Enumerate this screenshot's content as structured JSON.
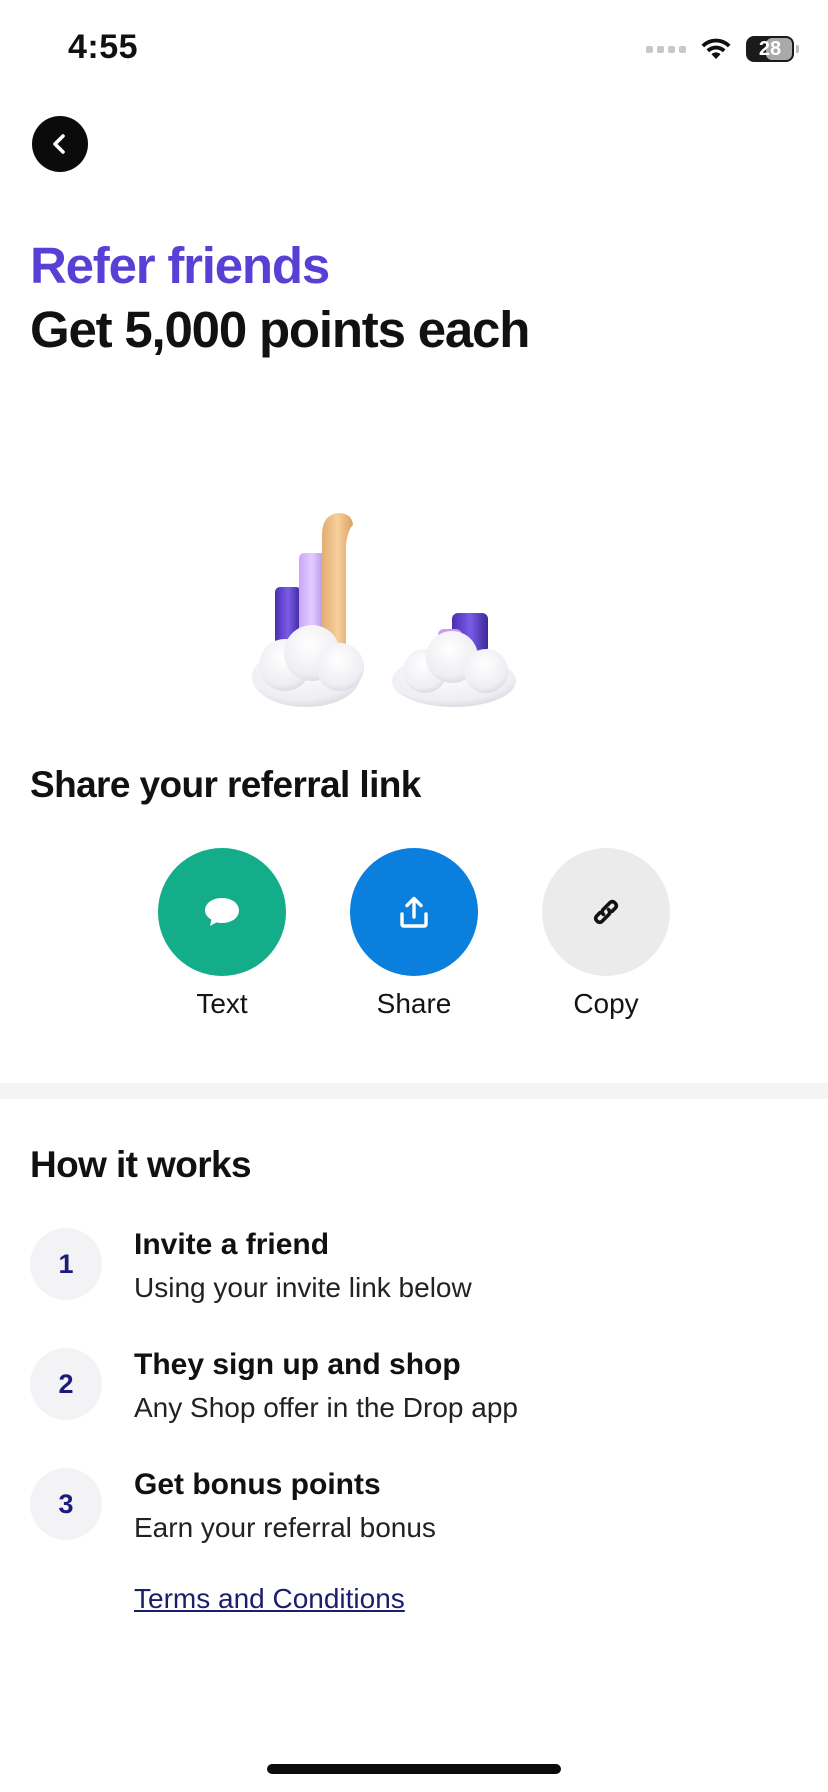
{
  "status_bar": {
    "time": "4:55",
    "battery_level": "28",
    "icons": [
      "signal-icon",
      "wifi-icon",
      "battery-icon"
    ]
  },
  "header": {
    "back_icon": "chevron-left-icon"
  },
  "hero": {
    "title": "Refer friends",
    "subtitle": "Get 5,000 points each",
    "title_color": "#5a3fd6"
  },
  "share": {
    "heading": "Share your referral link",
    "options": [
      {
        "label": "Text",
        "icon": "message-bubble-icon",
        "color": "#14ad8a"
      },
      {
        "label": "Share",
        "icon": "upload-icon",
        "color": "#0a7fde"
      },
      {
        "label": "Copy",
        "icon": "link-icon",
        "color": "#ebebeb"
      }
    ]
  },
  "how_it_works": {
    "heading": "How it works",
    "steps": [
      {
        "number": "1",
        "title": "Invite a friend",
        "description": "Using your invite link below"
      },
      {
        "number": "2",
        "title": "They sign up and shop",
        "description": "Any Shop offer in the Drop app"
      },
      {
        "number": "3",
        "title": "Get bonus points",
        "description": "Earn your referral bonus"
      }
    ],
    "terms_label": "Terms and Conditions"
  }
}
